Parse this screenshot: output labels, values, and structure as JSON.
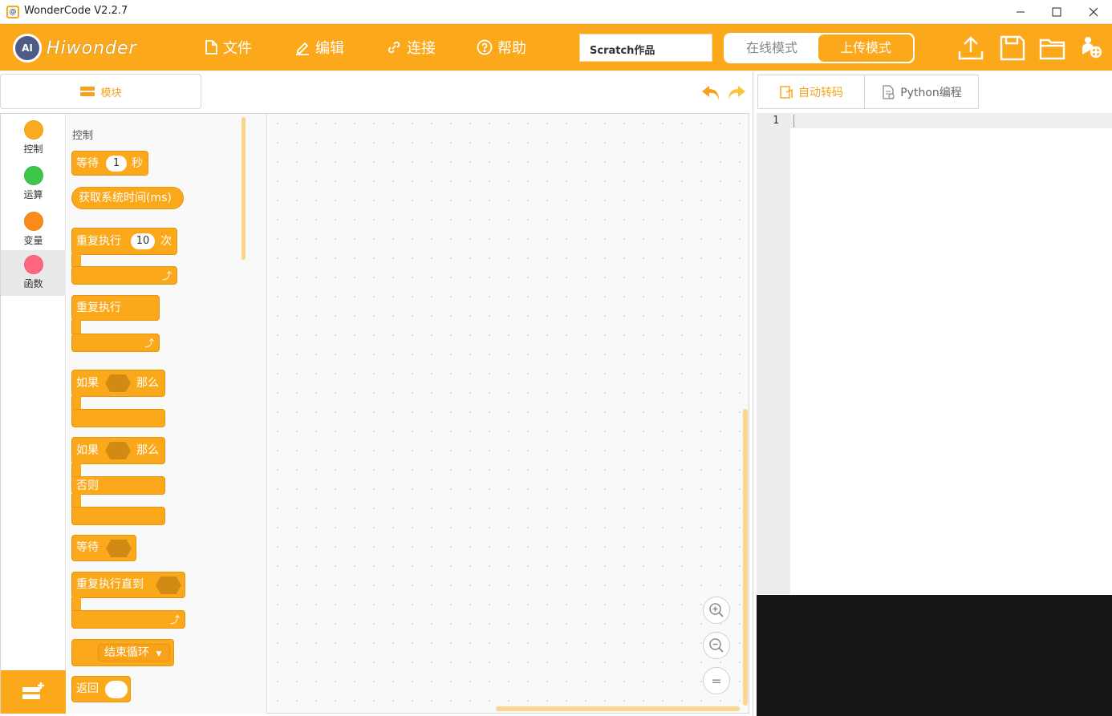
{
  "window": {
    "title": "WonderCode V2.2.7",
    "app_icon": "ai-robot-icon",
    "minimize": "—",
    "maximize": "☐",
    "close": "✕"
  },
  "toolbar": {
    "brand": "Hiwonder",
    "logo_text": "AI",
    "menus": [
      {
        "label": "文件",
        "icon": "file-icon"
      },
      {
        "label": "编辑",
        "icon": "edit-icon"
      },
      {
        "label": "连接",
        "icon": "link-icon"
      },
      {
        "label": "帮助",
        "icon": "help-icon"
      }
    ],
    "project_name": "Scratch作品",
    "mode_online": "在线模式",
    "mode_upload": "上传模式",
    "actions": [
      "upload-icon",
      "save-icon",
      "folder-icon",
      "user-globe-icon"
    ],
    "bg_color": "#fba81b"
  },
  "blocks_panel": {
    "tab_label": "模块",
    "categories": [
      {
        "label": "控制",
        "color": "#fbab1f"
      },
      {
        "label": "运算",
        "color": "#3ec64a"
      },
      {
        "label": "变量",
        "color": "#fb8c1a"
      },
      {
        "label": "函数",
        "color": "#ff6680"
      }
    ],
    "active_category": "函数",
    "flyout_title": "控制",
    "blocks": {
      "wait_prefix": "等待",
      "wait_value": "1",
      "wait_suffix": "秒",
      "get_time": "获取系统时间(ms)",
      "repeat_prefix": "重复执行",
      "repeat_value": "10",
      "repeat_suffix": "次",
      "forever": "重复执行",
      "if_prefix": "如果",
      "if_then": "那么",
      "if2_prefix": "如果",
      "if2_then": "那么",
      "else": "否则",
      "wait_until": "等待",
      "repeat_until": "重复执行直到",
      "break_loop": "结束循环",
      "return": "返回"
    }
  },
  "workspace": {
    "undo": "undo-icon",
    "redo": "redo-icon",
    "zoom_in": "zoom-in-icon",
    "zoom_out": "zoom-out-icon",
    "zoom_reset": "="
  },
  "code_panel": {
    "tab_auto": "自动转码",
    "tab_python": "Python编程",
    "line_numbers": [
      "1"
    ]
  }
}
